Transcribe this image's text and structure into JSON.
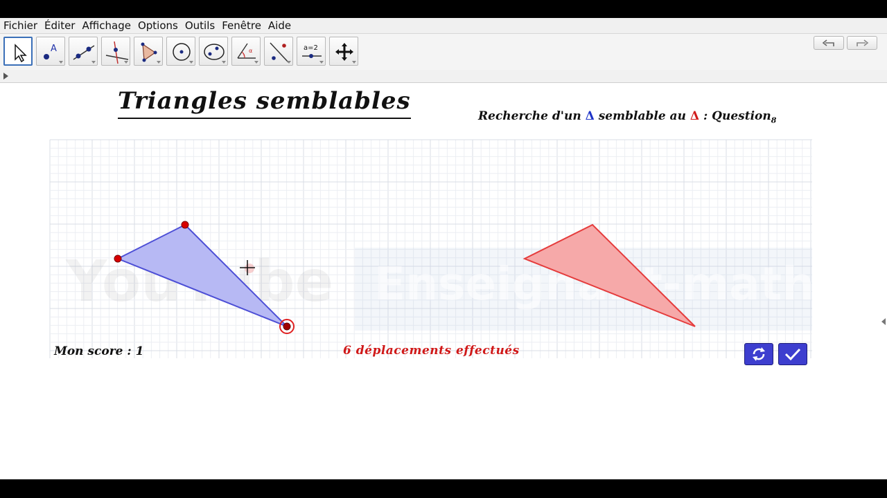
{
  "menu": {
    "items": [
      "Fichier",
      "Éditer",
      "Affichage",
      "Options",
      "Outils",
      "Fenêtre",
      "Aide"
    ]
  },
  "toolbar": {
    "tools": [
      {
        "name": "move-tool-icon",
        "selected": true
      },
      {
        "name": "point-tool-icon"
      },
      {
        "name": "line-tool-icon"
      },
      {
        "name": "perpendicular-line-tool-icon"
      },
      {
        "name": "polygon-tool-icon"
      },
      {
        "name": "circle-tool-icon"
      },
      {
        "name": "conic-tool-icon"
      },
      {
        "name": "angle-tool-icon"
      },
      {
        "name": "reflect-tool-icon"
      },
      {
        "name": "slider-tool-icon",
        "label": "a=2"
      },
      {
        "name": "move-graphics-view-tool-icon"
      }
    ],
    "undo_icon": "undo-icon",
    "redo_icon": "redo-icon",
    "help_icon": "help-icon",
    "settings_icon": "gear-icon"
  },
  "canvas": {
    "title": "Triangles semblables",
    "question": {
      "prefix": "Recherche d'un",
      "blue_symbol": "Δ",
      "middle": "semblable au",
      "red_symbol": "Δ",
      "suffix": ": Question",
      "number": "8"
    },
    "score_label": "Mon score  : 1",
    "moves_text": "6 déplacements effectués",
    "watermark_left": "YouTube",
    "watermark_right": "Enseignant-maths",
    "colors": {
      "blue_fill": "#b7b9f4",
      "blue_stroke": "#4d4fd6",
      "red_fill": "#f6a9a9",
      "red_stroke": "#e53c3c",
      "point": "#d80000",
      "button_bg": "#3d3ecf"
    },
    "buttons": {
      "refresh_icon": "refresh-icon",
      "validate_icon": "check-icon"
    }
  }
}
